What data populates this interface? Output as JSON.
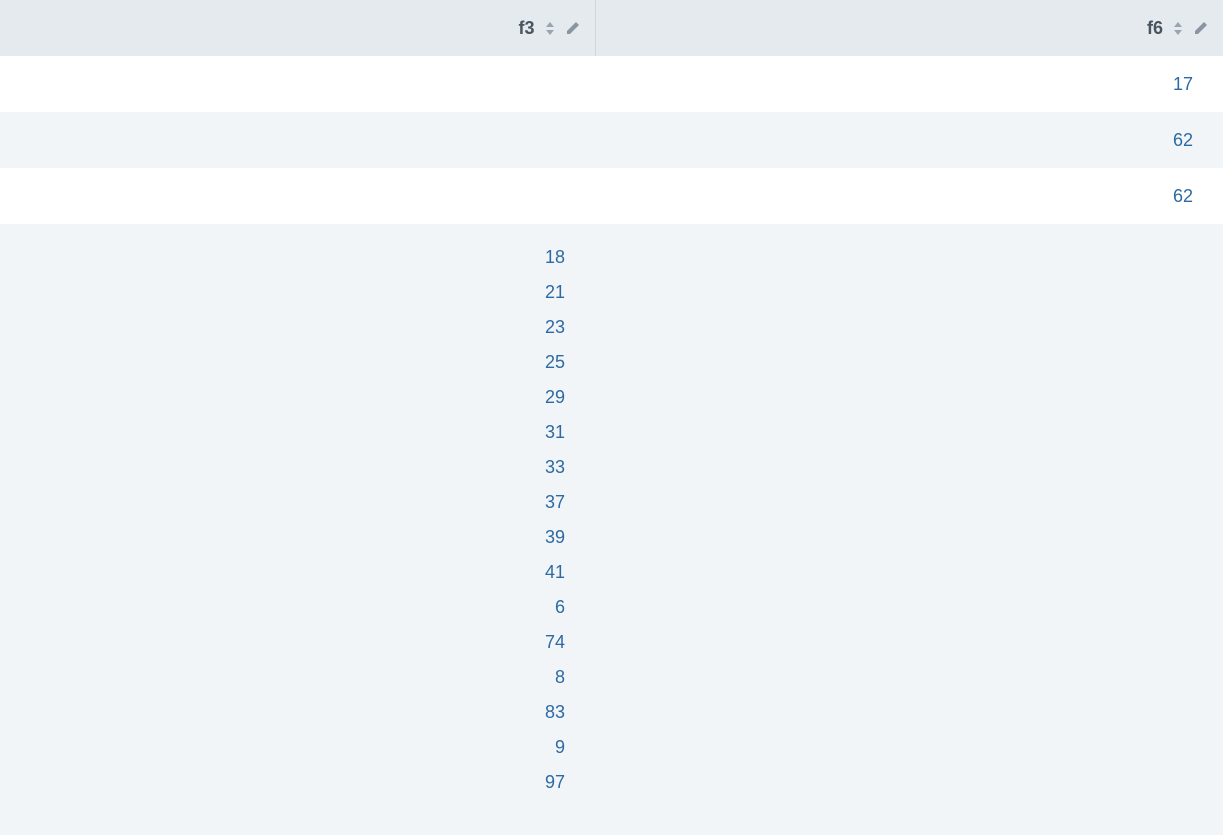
{
  "columns": {
    "f3": {
      "label": "f3"
    },
    "f6": {
      "label": "f6"
    }
  },
  "rows": [
    {
      "f3": "",
      "f6": "17",
      "bg": "white"
    },
    {
      "f3": "",
      "f6": "62",
      "bg": "shade"
    },
    {
      "f3": "",
      "f6": "62",
      "bg": "white"
    }
  ],
  "listRow": {
    "f3": [
      "18",
      "21",
      "23",
      "25",
      "29",
      "31",
      "33",
      "37",
      "39",
      "41",
      "6",
      "74",
      "8",
      "83",
      "9",
      "97"
    ]
  }
}
